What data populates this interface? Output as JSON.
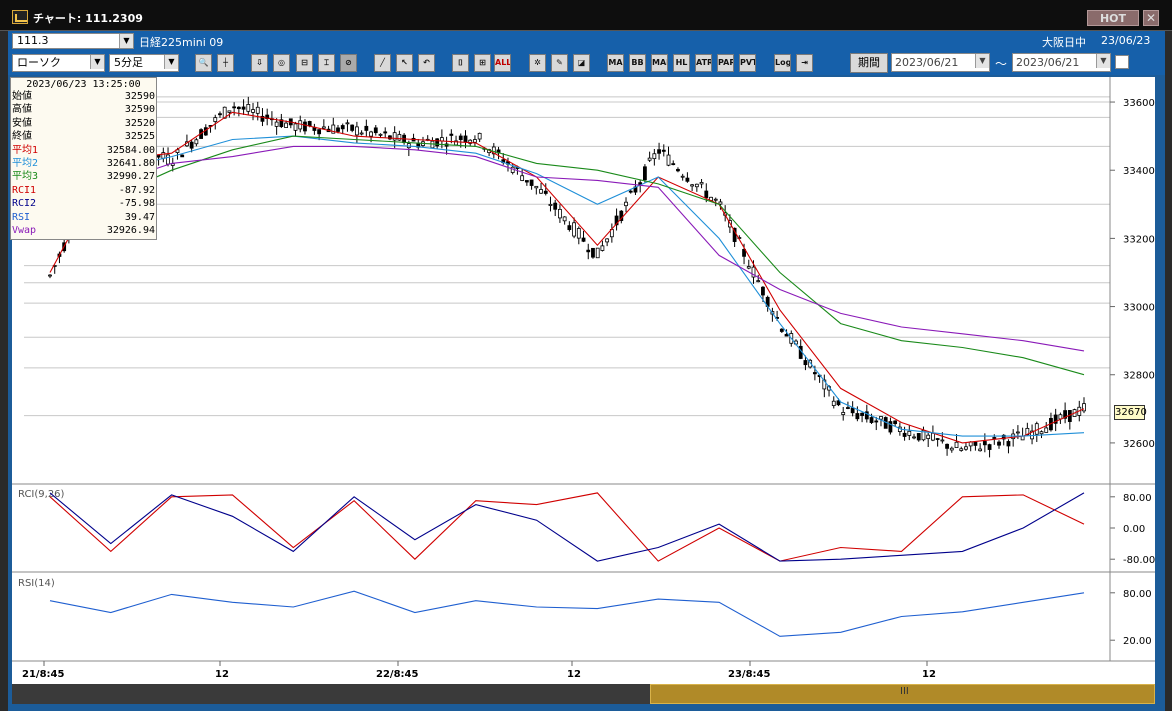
{
  "window": {
    "title": "チャート: 111.2309",
    "hot_label": "HOT",
    "close_label": "✕"
  },
  "toolbar": {
    "symbol_code": "111.3",
    "symbol_name": "日経225mini 09",
    "chart_type": "ローソク",
    "interval": "5分足",
    "market_status": "大阪日中",
    "market_date": "23/06/23",
    "period_label": "期間",
    "date_from": "2023/06/21",
    "date_to": "2023/06/21",
    "date_sep": "～",
    "buttons": [
      "MA",
      "BB",
      "MAE",
      "HL",
      "ATR",
      "PAR",
      "PVT",
      "Log",
      "ALL"
    ]
  },
  "info_panel": {
    "datetime": "2023/06/23  13:25:00",
    "rows": [
      {
        "key": "始値",
        "value": "32590",
        "color": "#000000"
      },
      {
        "key": "高値",
        "value": "32590",
        "color": "#000000"
      },
      {
        "key": "安値",
        "value": "32520",
        "color": "#000000"
      },
      {
        "key": "終値",
        "value": "32525",
        "color": "#000000"
      },
      {
        "key": "平均1",
        "value": "32584.00",
        "color": "#d00000"
      },
      {
        "key": "平均2",
        "value": "32641.80",
        "color": "#1f8fd8"
      },
      {
        "key": "平均3",
        "value": "32990.27",
        "color": "#1a8a1a"
      },
      {
        "key": "RCI1",
        "value": "-87.92",
        "color": "#d00000"
      },
      {
        "key": "RCI2",
        "value": "-75.98",
        "color": "#00008b"
      },
      {
        "key": "RSI",
        "value": "39.47",
        "color": "#1f5fd0"
      },
      {
        "key": "Vwap",
        "value": "32926.94",
        "color": "#8a1ab8"
      }
    ]
  },
  "price_axis": {
    "ticks": [
      "33600",
      "33400",
      "33200",
      "33000",
      "32800",
      "32600"
    ],
    "current": "32670"
  },
  "rci_panel": {
    "label": "RCI(9,26)",
    "ticks": [
      "80.00",
      "0.00",
      "-80.00"
    ]
  },
  "rsi_panel": {
    "label": "RSI(14)",
    "ticks": [
      "80.00",
      "20.00"
    ]
  },
  "time_axis": [
    "21/8:45",
    "12",
    "22/8:45",
    "12",
    "23/8:45",
    "12"
  ],
  "colors": {
    "candle": "#000000",
    "avg1": "#d00000",
    "avg2": "#1f8fd8",
    "avg3": "#1a8a1a",
    "vwap": "#8a1ab8",
    "rci1": "#d00000",
    "rci2": "#00008b",
    "rsi": "#1f5fd0"
  },
  "scrollbar": {
    "grip": "III"
  },
  "chart_data": {
    "type": "line",
    "title": "日経225mini 09",
    "candles": {
      "x_labels": [
        "21/8:45",
        "12",
        "22/8:45",
        "12",
        "23/8:45",
        "12"
      ],
      "series": [
        {
          "name": "終値",
          "values": [
            33090,
            33480,
            33430,
            33590,
            33530,
            33520,
            33480,
            33500,
            33350,
            33150,
            33460,
            33300,
            32950,
            32700,
            32640,
            32580,
            32620,
            32700
          ]
        }
      ]
    },
    "averages": [
      {
        "name": "平均1",
        "values": [
          33100,
          33430,
          33450,
          33570,
          33540,
          33500,
          33490,
          33480,
          33380,
          33180,
          33380,
          33300,
          32990,
          32760,
          32660,
          32600,
          32620,
          32700
        ]
      },
      {
        "name": "平均2",
        "values": [
          33250,
          33400,
          33440,
          33490,
          33500,
          33480,
          33470,
          33450,
          33390,
          33300,
          33380,
          33200,
          32950,
          32720,
          32640,
          32620,
          32620,
          32630
        ]
      },
      {
        "name": "平均3",
        "values": [
          33230,
          33320,
          33400,
          33460,
          33500,
          33490,
          33480,
          33470,
          33420,
          33400,
          33360,
          33300,
          33100,
          32950,
          32900,
          32880,
          32850,
          32800
        ]
      },
      {
        "name": "Vwap",
        "values": [
          33280,
          33360,
          33420,
          33440,
          33470,
          33470,
          33460,
          33440,
          33380,
          33370,
          33350,
          33150,
          33050,
          32980,
          32940,
          32920,
          32900,
          32870
        ]
      }
    ],
    "rci": {
      "ylim": [
        -100,
        100
      ],
      "series": [
        {
          "name": "RCI1",
          "values": [
            80,
            -60,
            80,
            85,
            -50,
            70,
            -80,
            70,
            60,
            90,
            -85,
            0,
            -85,
            -50,
            -60,
            80,
            85,
            10
          ]
        },
        {
          "name": "RCI2",
          "values": [
            90,
            -40,
            85,
            30,
            -60,
            80,
            -30,
            60,
            20,
            -85,
            -50,
            10,
            -85,
            -80,
            -70,
            -60,
            0,
            90
          ]
        }
      ]
    },
    "rsi": {
      "ylim": [
        0,
        100
      ],
      "series": [
        {
          "name": "RSI",
          "values": [
            70,
            55,
            78,
            68,
            62,
            82,
            55,
            70,
            62,
            60,
            72,
            68,
            25,
            30,
            50,
            56,
            68,
            80
          ]
        }
      ]
    },
    "ylim": [
      32500,
      33650
    ]
  }
}
